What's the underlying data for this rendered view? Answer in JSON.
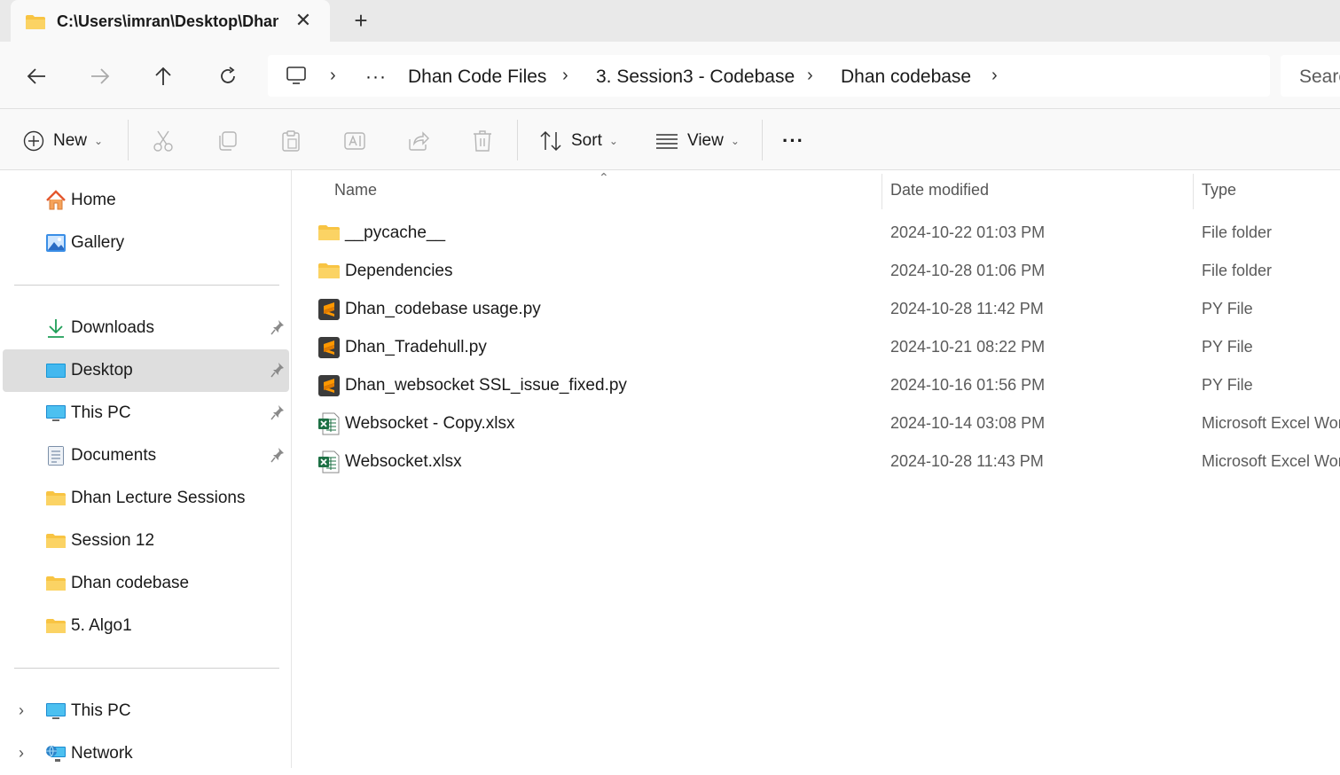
{
  "tab": {
    "title": "C:\\Users\\imran\\Desktop\\Dhan",
    "close": "✕",
    "new": "+"
  },
  "address": {
    "overflow": "···",
    "crumbs": [
      "Dhan Code Files",
      "3. Session3 - Codebase",
      "Dhan codebase"
    ],
    "search_placeholder": "Search"
  },
  "toolbar": {
    "new_label": "New",
    "sort_label": "Sort",
    "view_label": "View",
    "more": "···"
  },
  "sidebar": {
    "quick": [
      {
        "label": "Home",
        "icon": "home-icon"
      },
      {
        "label": "Gallery",
        "icon": "gallery-icon"
      }
    ],
    "pinned": [
      {
        "label": "Downloads",
        "icon": "download-icon",
        "pinned": true
      },
      {
        "label": "Desktop",
        "icon": "desktop-icon",
        "pinned": true,
        "selected": true
      },
      {
        "label": "This PC",
        "icon": "monitor-icon",
        "pinned": true
      },
      {
        "label": "Documents",
        "icon": "documents-icon",
        "pinned": true
      },
      {
        "label": "Dhan Lecture Sessions",
        "icon": "folder-icon"
      },
      {
        "label": "Session 12",
        "icon": "folder-icon"
      },
      {
        "label": "Dhan codebase",
        "icon": "folder-icon"
      },
      {
        "label": "5. Algo1",
        "icon": "folder-icon"
      }
    ],
    "roots": [
      {
        "label": "This PC",
        "icon": "monitor-icon"
      },
      {
        "label": "Network",
        "icon": "network-icon"
      }
    ]
  },
  "columns": {
    "name": "Name",
    "date": "Date modified",
    "type": "Type"
  },
  "files": [
    {
      "name": "__pycache__",
      "date": "2024-10-22 01:03 PM",
      "type": "File folder",
      "icon": "folder-icon"
    },
    {
      "name": "Dependencies",
      "date": "2024-10-28 01:06 PM",
      "type": "File folder",
      "icon": "folder-icon"
    },
    {
      "name": "Dhan_codebase usage.py",
      "date": "2024-10-28 11:42 PM",
      "type": "PY File",
      "icon": "sublime-file-icon"
    },
    {
      "name": "Dhan_Tradehull.py",
      "date": "2024-10-21 08:22 PM",
      "type": "PY File",
      "icon": "sublime-file-icon"
    },
    {
      "name": "Dhan_websocket SSL_issue_fixed.py",
      "date": "2024-10-16 01:56 PM",
      "type": "PY File",
      "icon": "sublime-file-icon"
    },
    {
      "name": "Websocket - Copy.xlsx",
      "date": "2024-10-14 03:08 PM",
      "type": "Microsoft Excel Worksheet",
      "icon": "excel-file-icon"
    },
    {
      "name": "Websocket.xlsx",
      "date": "2024-10-28 11:43 PM",
      "type": "Microsoft Excel Worksheet",
      "icon": "excel-file-icon"
    }
  ],
  "colors": {
    "folder": "#f8c443",
    "selected": "#dedede",
    "sublime": "#ff9800",
    "excel": "#1d7044"
  }
}
